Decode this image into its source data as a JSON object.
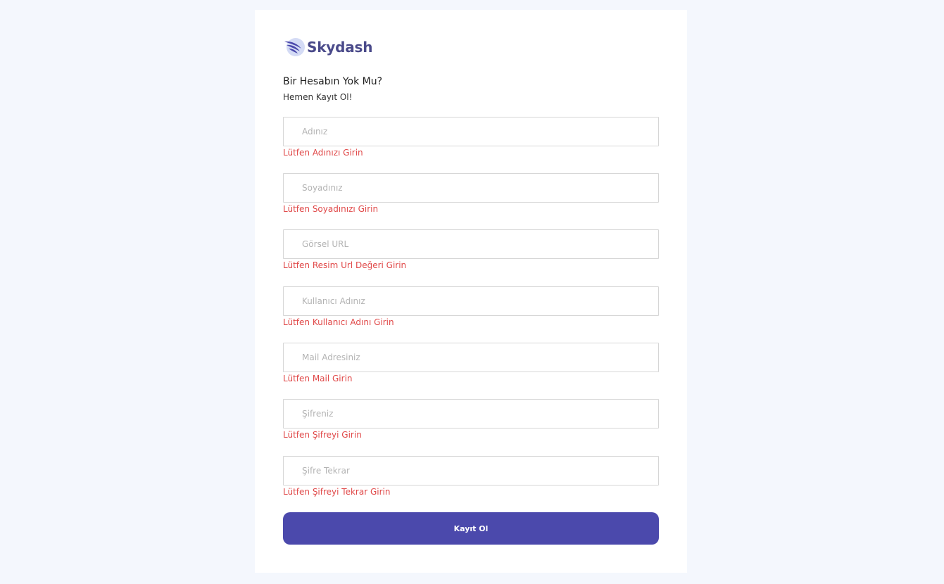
{
  "brand": {
    "name": "Skydash",
    "logo_icon": "wing-logo-icon"
  },
  "form": {
    "heading": "Bir Hesabın Yok Mu?",
    "subheading": "Hemen Kayıt Ol!",
    "fields": [
      {
        "placeholder": "Adınız",
        "value": "",
        "error": "Lütfen Adınızı Girin"
      },
      {
        "placeholder": "Soyadınız",
        "value": "",
        "error": "Lütfen Soyadınızı Girin"
      },
      {
        "placeholder": "Görsel URL",
        "value": "",
        "error": "Lütfen Resim Url Değeri Girin"
      },
      {
        "placeholder": "Kullanıcı Adınız",
        "value": "",
        "error": "Lütfen Kullanıcı Adını Girin"
      },
      {
        "placeholder": "Mail Adresiniz",
        "value": "",
        "error": "Lütfen Mail Girin"
      },
      {
        "placeholder": "Şifreniz",
        "value": "",
        "error": "Lütfen Şifreyi Girin"
      },
      {
        "placeholder": "Şifre Tekrar",
        "value": "",
        "error": "Lütfen Şifreyi Tekrar Girin"
      }
    ],
    "submit_label": "Kayıt Ol"
  },
  "colors": {
    "page_background": "#f4f7fd",
    "card_background": "#ffffff",
    "primary": "#4b49ac",
    "error": "#e04848",
    "input_border": "#d6d6d6",
    "brand_text": "#4a4a8a"
  }
}
